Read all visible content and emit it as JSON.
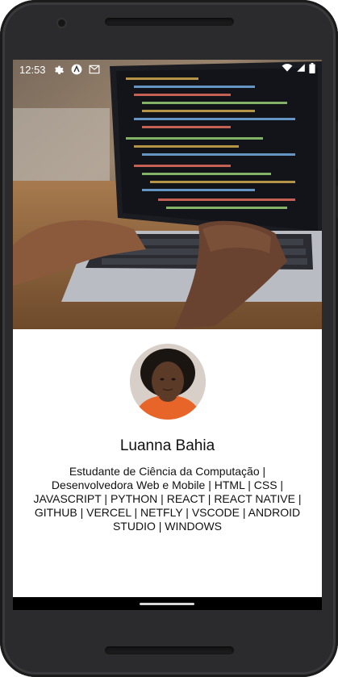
{
  "status_bar": {
    "time": "12:53",
    "icons": [
      "gear-icon",
      "app-a-icon",
      "gmail-icon"
    ],
    "right_icons": [
      "wifi-icon",
      "signal-icon",
      "battery-icon"
    ]
  },
  "profile": {
    "name": "Luanna Bahia",
    "bio": "Estudante de Ciência da Computação | Desenvolvedora Web e Mobile | HTML | CSS | JAVASCRIPT | PYTHON | REACT | REACT NATIVE | GITHUB | VERCEL | NETFLY | VSCODE | ANDROID STUDIO | WINDOWS"
  },
  "colors": {
    "accent": "#e8652a",
    "text": "#111111",
    "background": "#ffffff"
  }
}
